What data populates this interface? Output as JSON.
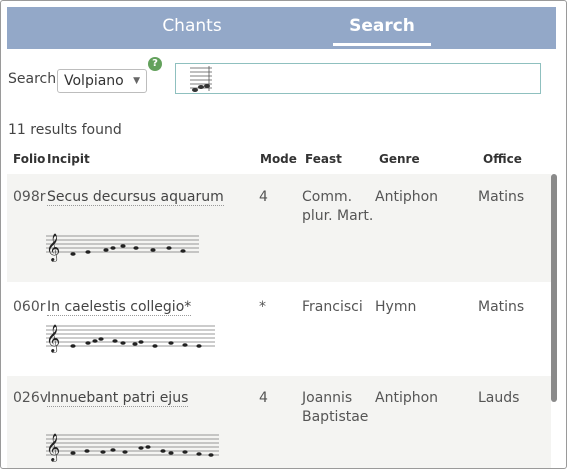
{
  "tabs": [
    {
      "label": "Chants",
      "active": false
    },
    {
      "label": "Search",
      "active": true
    }
  ],
  "search": {
    "label": "Search",
    "mode_value": "Volpiano",
    "help_glyph": "?"
  },
  "results_count": "11 results found",
  "columns": {
    "folio": "Folio",
    "incipit": "Incipit",
    "mode": "Mode",
    "feast": "Feast",
    "genre": "Genre",
    "office": "Office"
  },
  "rows": [
    {
      "folio": "098r",
      "incipit": "Secus decursus aquarum",
      "mode": "4",
      "feast_line1": "Comm.",
      "feast_line2": "plur. Mart.",
      "genre": "Antiphon",
      "office": "Matins"
    },
    {
      "folio": "060r",
      "incipit": "In caelestis collegio*",
      "mode": "*",
      "feast_line1": "Francisci",
      "feast_line2": "",
      "genre": "Hymn",
      "office": "Matins"
    },
    {
      "folio": "026v",
      "incipit": "Innuebant patri ejus",
      "mode": "4",
      "feast_line1": "Joannis",
      "feast_line2": "Baptistae",
      "genre": "Antiphon",
      "office": "Lauds"
    }
  ],
  "colors": {
    "topbar": "#93a8c8",
    "help_badge": "#63a15c",
    "input_border": "#8fc0bf",
    "row_shade": "#f4f4f2"
  },
  "icons": {
    "help": "help-icon",
    "dropdown": "chevron-down-icon",
    "clef": "treble-clef-icon"
  }
}
